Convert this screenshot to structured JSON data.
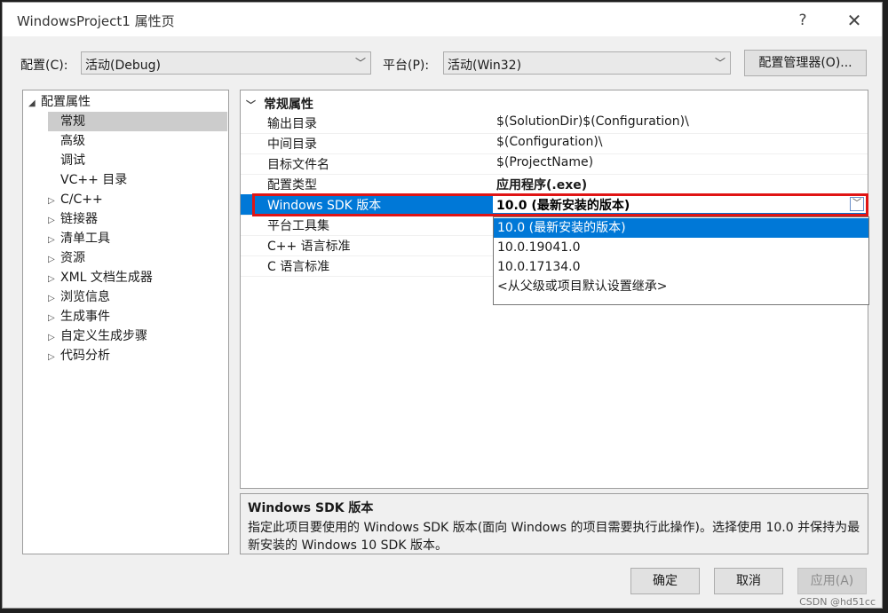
{
  "window": {
    "title": "WindowsProject1 属性页",
    "help": "?",
    "close": "✕"
  },
  "config": {
    "config_label": "配置(C):",
    "config_value": "活动(Debug)",
    "platform_label": "平台(P):",
    "platform_value": "活动(Win32)",
    "manager_button": "配置管理器(O)..."
  },
  "tree": {
    "root": "配置属性",
    "children": [
      "常规",
      "高级",
      "调试",
      "VC++ 目录"
    ],
    "collapsed": [
      "C/C++",
      "链接器",
      "清单工具",
      "资源",
      "XML 文档生成器",
      "浏览信息",
      "生成事件",
      "自定义生成步骤",
      "代码分析"
    ],
    "selected": "常规"
  },
  "grid": {
    "section": "常规属性",
    "rows": [
      {
        "name": "输出目录",
        "value": "$(SolutionDir)$(Configuration)\\"
      },
      {
        "name": "中间目录",
        "value": "$(Configuration)\\"
      },
      {
        "name": "目标文件名",
        "value": "$(ProjectName)"
      },
      {
        "name": "配置类型",
        "value": "应用程序(.exe)"
      },
      {
        "name": "Windows SDK 版本",
        "value": "10.0 (最新安装的版本)"
      },
      {
        "name": "平台工具集",
        "value": ""
      },
      {
        "name": "C++ 语言标准",
        "value": ""
      },
      {
        "name": "C 语言标准",
        "value": ""
      }
    ]
  },
  "dropdown": {
    "options": [
      "10.0 (最新安装的版本)",
      "10.0.19041.0",
      "10.0.17134.0",
      "<从父级或项目默认设置继承>"
    ],
    "highlighted": "10.0 (最新安装的版本)"
  },
  "description": {
    "title": "Windows SDK 版本",
    "text": "指定此项目要使用的 Windows SDK 版本(面向 Windows 的项目需要执行此操作)。选择使用 10.0 并保持为最新安装的 Windows 10 SDK 版本。"
  },
  "buttons": {
    "ok": "确定",
    "cancel": "取消",
    "apply": "应用(A)"
  },
  "watermark": "CSDN @hd51cc",
  "colors": {
    "selection": "#0078d7",
    "highlight_box": "#e01515"
  }
}
